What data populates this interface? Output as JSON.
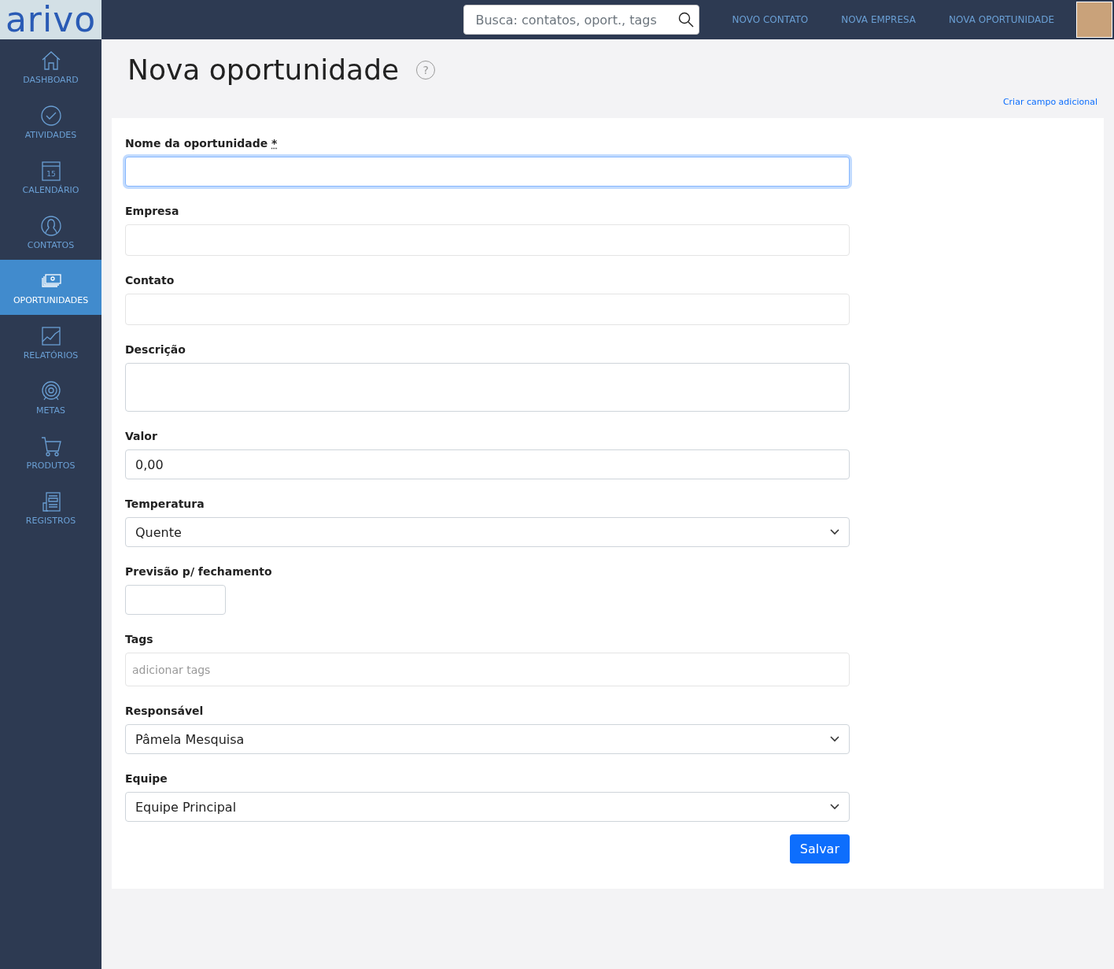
{
  "logo": "arivo",
  "sidebar": {
    "items": [
      {
        "label": "DASHBOARD",
        "selected": false
      },
      {
        "label": "ATIVIDADES",
        "selected": false
      },
      {
        "label": "CALENDÁRIO",
        "selected": false,
        "icon_text": "15"
      },
      {
        "label": "CONTATOS",
        "selected": false
      },
      {
        "label": "OPORTUNIDADES",
        "selected": true
      },
      {
        "label": "RELATÓRIOS",
        "selected": false
      },
      {
        "label": "METAS",
        "selected": false
      },
      {
        "label": "PRODUTOS",
        "selected": false
      },
      {
        "label": "REGISTROS",
        "selected": false
      }
    ]
  },
  "topbar": {
    "search": {
      "placeholder": "Busca: contatos, oport., tags"
    },
    "links": [
      "NOVO CONTATO",
      "NOVA EMPRESA",
      "NOVA OPORTUNIDADE"
    ]
  },
  "page": {
    "title": "Nova oportunidade",
    "help": "?",
    "extra_link": "Criar campo adicional"
  },
  "form": {
    "fields": [
      {
        "kind": "text",
        "label": "Nome da oportunidade",
        "required_mark": "*",
        "focused": true
      },
      {
        "kind": "lookup",
        "label": "Empresa",
        "focused": false
      },
      {
        "kind": "lookup",
        "label": "Contato",
        "focused": false
      },
      {
        "kind": "textarea",
        "label": "Descrição",
        "focused": false
      },
      {
        "kind": "text",
        "label": "Valor",
        "value": "0,00",
        "focused": false
      },
      {
        "kind": "select",
        "label": "Temperatura",
        "value": "Quente",
        "focused": false
      },
      {
        "kind": "date",
        "label": "Previsão p/ fechamento",
        "focused": false
      },
      {
        "kind": "tags",
        "label": "Tags",
        "placeholder": "adicionar tags",
        "focused": false
      },
      {
        "kind": "select",
        "label": "Responsável",
        "value": "Pâmela Mesquisa",
        "focused": false
      },
      {
        "kind": "select",
        "label": "Equipe",
        "value": "Equipe Principal",
        "focused": false
      }
    ],
    "submit": "Salvar"
  }
}
